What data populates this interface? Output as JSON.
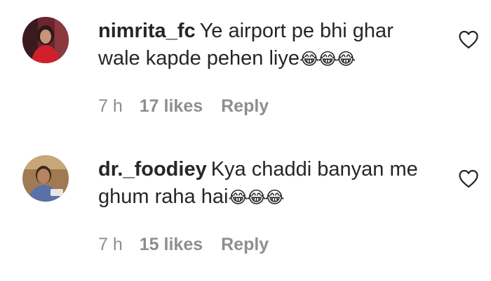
{
  "comments": [
    {
      "username": "nimrita_fc",
      "text": "Ye airport pe bhi ghar wale kapde pehen liye",
      "emojis": "😂😂😂",
      "time": "7 h",
      "likes": "17 likes",
      "reply": "Reply",
      "avatar_icon": "profile-photo-icon",
      "like_icon": "heart-outline-icon"
    },
    {
      "username": "dr._foodiey",
      "text": "Kya chaddi banyan me ghum raha hai",
      "emojis": "😂😂😂",
      "time": "7 h",
      "likes": "15 likes",
      "reply": "Reply",
      "avatar_icon": "profile-photo-icon",
      "like_icon": "heart-outline-icon"
    }
  ],
  "colors": {
    "text": "#262626",
    "secondary": "#8e8e8e",
    "background": "#ffffff"
  }
}
